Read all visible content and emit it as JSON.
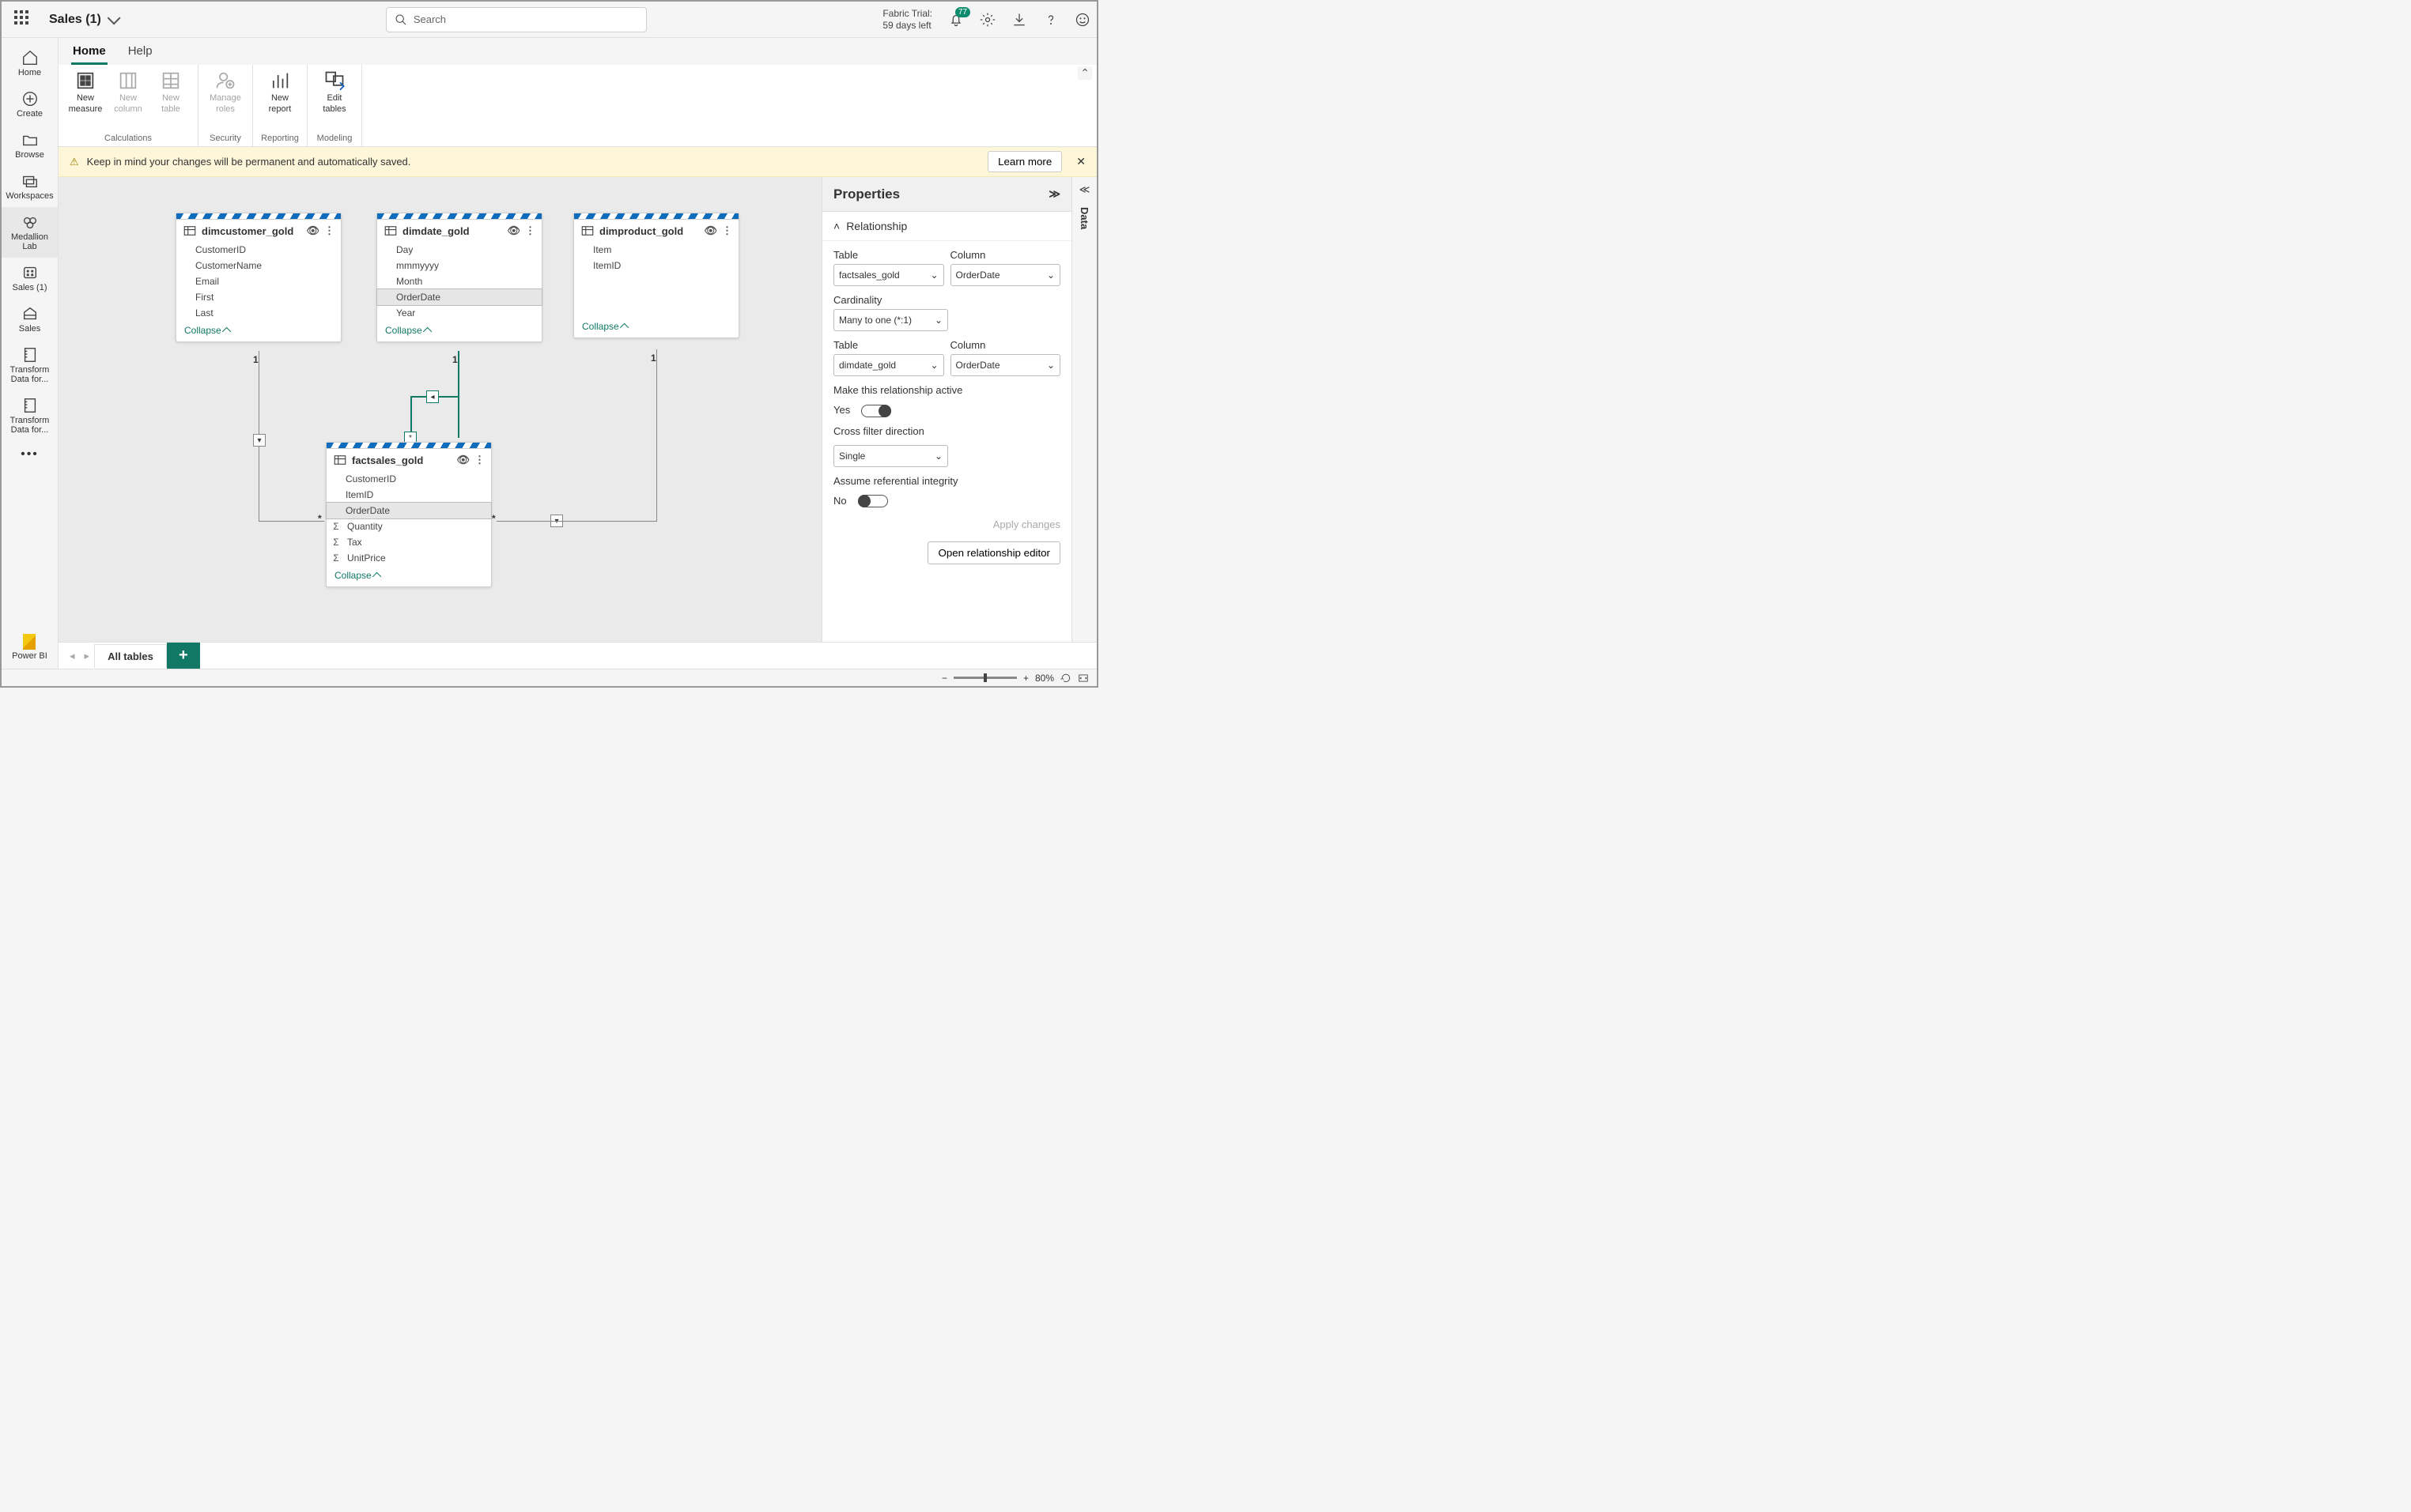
{
  "header": {
    "title": "Sales (1)",
    "search_placeholder": "Search",
    "trial_line1": "Fabric Trial:",
    "trial_line2": "59 days left",
    "notif_count": "77"
  },
  "leftnav": {
    "items": [
      {
        "label": "Home"
      },
      {
        "label": "Create"
      },
      {
        "label": "Browse"
      },
      {
        "label": "Workspaces"
      },
      {
        "label": "Medallion Lab"
      },
      {
        "label": "Sales (1)"
      },
      {
        "label": "Sales"
      },
      {
        "label": "Transform Data for..."
      },
      {
        "label": "Transform Data for..."
      }
    ],
    "brand": "Power BI"
  },
  "tabs": {
    "home": "Home",
    "help": "Help"
  },
  "ribbon": {
    "calc_label": "Calculations",
    "sec_label": "Security",
    "rep_label": "Reporting",
    "mod_label": "Modeling",
    "new_measure_l1": "New",
    "new_measure_l2": "measure",
    "new_column_l1": "New",
    "new_column_l2": "column",
    "new_table_l1": "New",
    "new_table_l2": "table",
    "manage_roles_l1": "Manage",
    "manage_roles_l2": "roles",
    "new_report_l1": "New",
    "new_report_l2": "report",
    "edit_tables_l1": "Edit",
    "edit_tables_l2": "tables"
  },
  "banner": {
    "text": "Keep in mind your changes will be permanent and automatically saved.",
    "learn": "Learn more"
  },
  "entities": {
    "dimcustomer": {
      "name": "dimcustomer_gold",
      "fields": [
        "CustomerID",
        "CustomerName",
        "Email",
        "First",
        "Last"
      ],
      "collapse": "Collapse"
    },
    "dimdate": {
      "name": "dimdate_gold",
      "fields": [
        "Day",
        "mmmyyyy",
        "Month",
        "OrderDate",
        "Year"
      ],
      "collapse": "Collapse"
    },
    "dimproduct": {
      "name": "dimproduct_gold",
      "fields": [
        "Item",
        "ItemID"
      ],
      "collapse": "Collapse"
    },
    "factsales": {
      "name": "factsales_gold",
      "fields": [
        "CustomerID",
        "ItemID",
        "OrderDate",
        "Quantity",
        "Tax",
        "UnitPrice"
      ],
      "collapse": "Collapse"
    }
  },
  "properties": {
    "title": "Properties",
    "section": "Relationship",
    "table_lbl": "Table",
    "column_lbl": "Column",
    "table1": "factsales_gold",
    "column1": "OrderDate",
    "card_lbl": "Cardinality",
    "card_val": "Many to one (*:1)",
    "table2": "dimdate_gold",
    "column2": "OrderDate",
    "active_lbl": "Make this relationship active",
    "active_val": "Yes",
    "cross_lbl": "Cross filter direction",
    "cross_val": "Single",
    "ref_lbl": "Assume referential integrity",
    "ref_val": "No",
    "apply": "Apply changes",
    "open_editor": "Open relationship editor"
  },
  "rightrail": {
    "data": "Data"
  },
  "bottom": {
    "all_tables": "All tables"
  },
  "status": {
    "zoom": "80%"
  }
}
